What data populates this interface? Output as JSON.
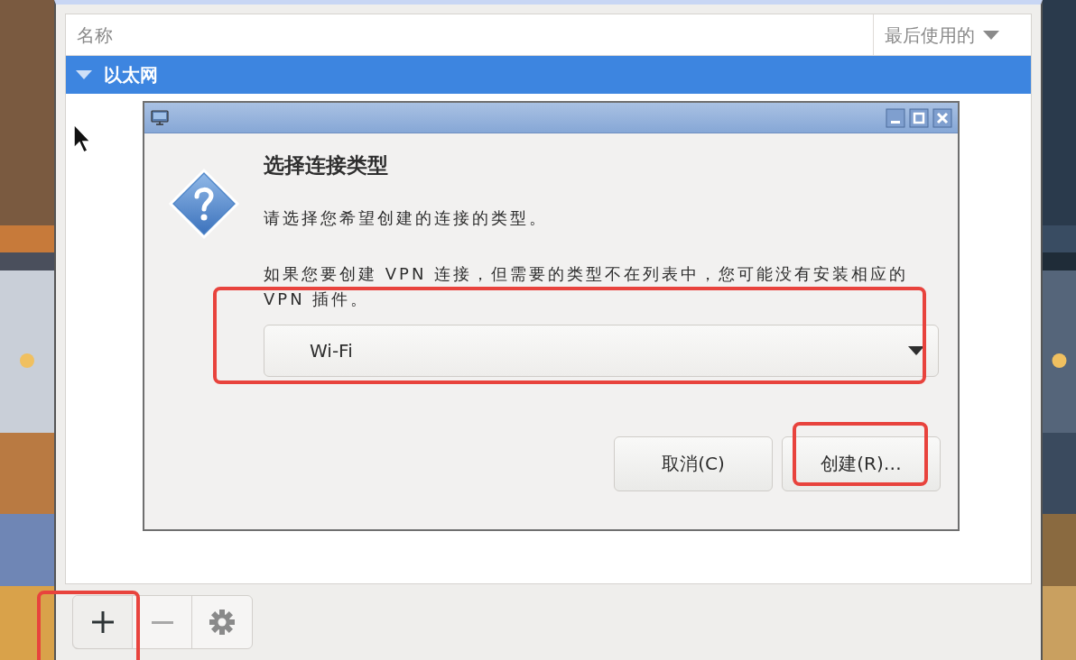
{
  "window": {
    "columns": [
      {
        "label": "名称",
        "sorted": false
      },
      {
        "label": "最后使用的",
        "sorted": true
      }
    ],
    "groups": [
      {
        "label": "以太网",
        "expanded": true,
        "selected": true
      }
    ],
    "toolbar": [
      {
        "kind": "add",
        "disabled": false,
        "highlighted": true
      },
      {
        "kind": "remove",
        "disabled": true,
        "highlighted": false
      },
      {
        "kind": "settings",
        "disabled": false,
        "highlighted": false
      }
    ]
  },
  "dialog": {
    "heading": "选择连接类型",
    "text": "请选择您希望创建的连接的类型。",
    "note": "如果您要创建 VPN 连接，但需要的类型不在列表中，您可能没有安装相应的 VPN 插件。",
    "connection_type": {
      "value": "Wi-Fi",
      "highlighted": true
    },
    "buttons": [
      {
        "label": "取消(C)",
        "highlighted": false
      },
      {
        "label": "创建(R)…",
        "highlighted": true
      }
    ]
  }
}
